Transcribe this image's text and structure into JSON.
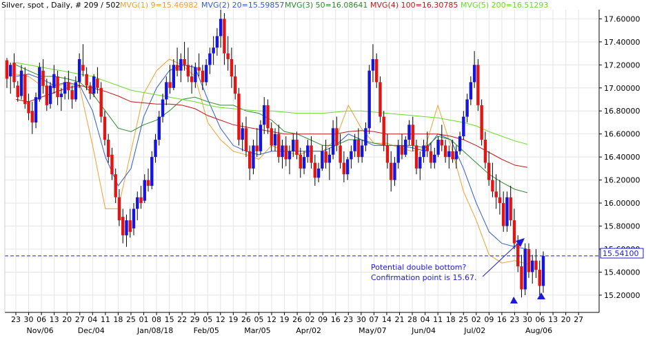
{
  "header": {
    "instrument": "Silver, spot , Daily, # 209 / 502",
    "ma_labels": [
      {
        "text": "MVG(1) 9=15.46982",
        "color": "#f0a030"
      },
      {
        "text": "MVG(2) 20=15.59857",
        "color": "#2e5bd0"
      },
      {
        "text": "MVG(3) 50=16.08641",
        "color": "#2a8a2a"
      },
      {
        "text": "MVG(4) 100=16.30785",
        "color": "#c81414"
      },
      {
        "text": "MVG(5) 200=16.51293",
        "color": "#66dd22"
      }
    ]
  },
  "annotation": {
    "line1": "Potential double bottom?",
    "line2": "Confirmation point is 15.67.",
    "color": "#1a1ad8"
  },
  "price_tag": "15.54100",
  "chart_data": {
    "type": "candlestick",
    "ylim": [
      15.05,
      17.68
    ],
    "yticks": [
      "17.60000",
      "17.40000",
      "17.20000",
      "17.00000",
      "16.80000",
      "16.60000",
      "16.40000",
      "16.20000",
      "16.00000",
      "15.80000",
      "15.60000",
      "15.40000",
      "15.20000"
    ],
    "ytick_values": [
      17.6,
      17.4,
      17.2,
      17.0,
      16.8,
      16.6,
      16.4,
      16.2,
      16.0,
      15.8,
      15.6,
      15.4,
      15.2
    ],
    "x_day_labels": [
      "23",
      "30",
      "06",
      "13",
      "20",
      "27",
      "04",
      "11",
      "18",
      "25",
      "01",
      "08",
      "15",
      "22",
      "29",
      "05",
      "12",
      "19",
      "26",
      "05",
      "12",
      "19",
      "26",
      "02",
      "09",
      "16",
      "23",
      "30",
      "07",
      "14",
      "21",
      "28",
      "04",
      "11",
      "18",
      "25",
      "02",
      "09",
      "16",
      "23",
      "30",
      "06",
      "13",
      "20",
      "27"
    ],
    "x_month_labels": [
      {
        "text": "Nov/06",
        "at": 2
      },
      {
        "text": "Dec/04",
        "at": 6
      },
      {
        "text": "Jan/08/18",
        "at": 11
      },
      {
        "text": "Feb/05",
        "at": 15
      },
      {
        "text": "Mar/05",
        "at": 19
      },
      {
        "text": "Apr/02",
        "at": 23
      },
      {
        "text": "May/07",
        "at": 28
      },
      {
        "text": "Jun/04",
        "at": 32
      },
      {
        "text": "Jul/02",
        "at": 36
      },
      {
        "text": "Aug/06",
        "at": 41
      }
    ],
    "last_price": 15.541,
    "weekly_close": [
      17.15,
      17.05,
      16.95,
      17.0,
      17.05,
      16.95,
      16.3,
      15.8,
      16.1,
      16.7,
      17.1,
      17.2,
      17.3,
      17.15,
      17.05,
      16.6,
      16.5,
      16.4,
      16.4,
      16.35,
      16.55,
      16.45,
      16.4,
      16.5,
      16.45,
      16.6,
      17.05,
      16.6,
      16.5,
      16.55,
      16.45,
      16.45,
      16.5,
      16.95,
      16.45,
      16.1,
      15.85,
      15.5,
      15.45,
      15.52,
      15.541
    ],
    "ma_series": [
      {
        "name": "MVG(1) 9",
        "color": "#f0a030",
        "values": [
          17.12,
          17.1,
          17.02,
          17.0,
          17.05,
          17.0,
          16.5,
          15.95,
          15.95,
          16.45,
          16.95,
          17.15,
          17.25,
          17.2,
          17.1,
          16.7,
          16.55,
          16.45,
          16.42,
          16.38,
          16.5,
          16.45,
          16.42,
          16.45,
          16.45,
          16.55,
          16.85,
          16.65,
          16.52,
          16.52,
          16.48,
          16.45,
          16.48,
          16.85,
          16.5,
          16.1,
          15.85,
          15.55,
          15.48,
          15.5,
          15.47
        ]
      },
      {
        "name": "MVG(2) 20",
        "color": "#2e5bd0",
        "values": [
          17.1,
          17.12,
          17.08,
          17.02,
          17.05,
          17.02,
          16.8,
          16.4,
          16.15,
          16.3,
          16.75,
          17.0,
          17.15,
          17.2,
          17.18,
          16.9,
          16.65,
          16.5,
          16.45,
          16.42,
          16.45,
          16.45,
          16.45,
          16.45,
          16.45,
          16.5,
          16.6,
          16.55,
          16.5,
          16.5,
          16.5,
          16.48,
          16.45,
          16.6,
          16.55,
          16.3,
          16.0,
          15.75,
          15.65,
          15.62,
          15.6
        ]
      },
      {
        "name": "MVG(3) 50",
        "color": "#2a8a2a",
        "values": [
          17.2,
          17.15,
          17.1,
          17.1,
          17.08,
          17.05,
          16.95,
          16.8,
          16.65,
          16.62,
          16.68,
          16.72,
          16.8,
          16.9,
          16.92,
          16.88,
          16.85,
          16.85,
          16.8,
          16.78,
          16.72,
          16.62,
          16.6,
          16.55,
          16.5,
          16.5,
          16.55,
          16.55,
          16.52,
          16.5,
          16.5,
          16.5,
          16.48,
          16.58,
          16.55,
          16.45,
          16.35,
          16.25,
          16.18,
          16.12,
          16.09
        ]
      },
      {
        "name": "MVG(4) 100",
        "color": "#c81414",
        "values": [
          16.9,
          16.88,
          16.92,
          16.96,
          17.0,
          17.02,
          17.0,
          16.97,
          16.93,
          16.88,
          16.87,
          16.86,
          16.86,
          16.85,
          16.82,
          16.76,
          16.72,
          16.68,
          16.66,
          16.64,
          16.62,
          16.6,
          16.6,
          16.6,
          16.6,
          16.6,
          16.62,
          16.63,
          16.62,
          16.6,
          16.6,
          16.6,
          16.6,
          16.6,
          16.58,
          16.55,
          16.5,
          16.44,
          16.38,
          16.33,
          16.31
        ]
      },
      {
        "name": "MVG(5) 200",
        "color": "#66dd22",
        "values": [
          17.22,
          17.2,
          17.18,
          17.16,
          17.14,
          17.12,
          17.1,
          17.06,
          17.02,
          16.98,
          16.96,
          16.94,
          16.92,
          16.9,
          16.88,
          16.85,
          16.83,
          16.82,
          16.81,
          16.8,
          16.8,
          16.79,
          16.78,
          16.78,
          16.78,
          16.79,
          16.8,
          16.8,
          16.79,
          16.78,
          16.77,
          16.76,
          16.75,
          16.74,
          16.72,
          16.7,
          16.67,
          16.62,
          16.58,
          16.54,
          16.51
        ]
      }
    ],
    "candles": [
      [
        17.24,
        17.26,
        17.0,
        17.08
      ],
      [
        17.1,
        17.22,
        16.95,
        17.2
      ],
      [
        17.22,
        17.3,
        17.0,
        17.05
      ],
      [
        17.02,
        17.06,
        16.88,
        16.92
      ],
      [
        16.93,
        17.2,
        16.9,
        17.15
      ],
      [
        17.12,
        17.18,
        16.82,
        16.86
      ],
      [
        16.88,
        16.95,
        16.72,
        16.78
      ],
      [
        16.8,
        16.88,
        16.6,
        16.7
      ],
      [
        16.7,
        16.96,
        16.65,
        16.92
      ],
      [
        16.9,
        17.22,
        16.88,
        17.18
      ],
      [
        17.15,
        17.25,
        16.95,
        17.02
      ],
      [
        17.02,
        17.08,
        16.8,
        16.85
      ],
      [
        16.86,
        17.05,
        16.82,
        17.02
      ],
      [
        17.0,
        17.2,
        16.95,
        17.12
      ],
      [
        17.1,
        17.15,
        16.85,
        16.92
      ],
      [
        16.92,
        17.0,
        16.8,
        16.95
      ],
      [
        16.95,
        17.1,
        16.9,
        17.05
      ],
      [
        17.05,
        17.15,
        16.9,
        16.98
      ],
      [
        16.98,
        17.02,
        16.82,
        16.9
      ],
      [
        16.9,
        17.1,
        16.88,
        17.05
      ],
      [
        17.05,
        17.3,
        17.0,
        17.25
      ],
      [
        17.2,
        17.38,
        17.1,
        17.15
      ],
      [
        17.12,
        17.18,
        16.98,
        17.02
      ],
      [
        17.02,
        17.05,
        16.9,
        16.95
      ],
      [
        16.95,
        17.12,
        16.92,
        17.1
      ],
      [
        17.08,
        17.18,
        16.95,
        17.0
      ],
      [
        17.0,
        17.05,
        16.7,
        16.75
      ],
      [
        16.75,
        16.8,
        16.5,
        16.55
      ],
      [
        16.55,
        16.6,
        16.35,
        16.4
      ],
      [
        16.42,
        16.48,
        16.2,
        16.25
      ],
      [
        16.25,
        16.3,
        16.0,
        16.05
      ],
      [
        16.05,
        16.12,
        15.8,
        15.85
      ],
      [
        15.88,
        15.95,
        15.65,
        15.72
      ],
      [
        15.72,
        15.9,
        15.62,
        15.85
      ],
      [
        15.85,
        15.95,
        15.7,
        15.75
      ],
      [
        15.78,
        16.0,
        15.72,
        15.95
      ],
      [
        15.95,
        16.1,
        15.85,
        16.05
      ],
      [
        16.05,
        16.15,
        15.95,
        16.0
      ],
      [
        16.02,
        16.25,
        16.0,
        16.2
      ],
      [
        16.2,
        16.3,
        16.1,
        16.15
      ],
      [
        16.15,
        16.45,
        16.12,
        16.4
      ],
      [
        16.4,
        16.6,
        16.35,
        16.55
      ],
      [
        16.55,
        16.8,
        16.5,
        16.75
      ],
      [
        16.75,
        16.95,
        16.7,
        16.9
      ],
      [
        16.9,
        17.1,
        16.85,
        17.05
      ],
      [
        17.05,
        17.2,
        16.95,
        17.0
      ],
      [
        17.0,
        17.25,
        16.98,
        17.2
      ],
      [
        17.2,
        17.35,
        17.1,
        17.15
      ],
      [
        17.15,
        17.3,
        17.05,
        17.25
      ],
      [
        17.25,
        17.4,
        17.15,
        17.2
      ],
      [
        17.2,
        17.35,
        17.05,
        17.1
      ],
      [
        17.1,
        17.2,
        16.95,
        17.05
      ],
      [
        17.05,
        17.22,
        17.0,
        17.18
      ],
      [
        17.18,
        17.3,
        17.1,
        17.15
      ],
      [
        17.15,
        17.2,
        16.98,
        17.05
      ],
      [
        17.05,
        17.25,
        17.02,
        17.2
      ],
      [
        17.2,
        17.35,
        17.12,
        17.3
      ],
      [
        17.3,
        17.45,
        17.2,
        17.35
      ],
      [
        17.35,
        17.52,
        17.28,
        17.45
      ],
      [
        17.45,
        17.68,
        17.35,
        17.6
      ],
      [
        17.6,
        17.65,
        17.2,
        17.3
      ],
      [
        17.3,
        17.45,
        17.15,
        17.25
      ],
      [
        17.25,
        17.35,
        17.0,
        17.1
      ],
      [
        17.1,
        17.2,
        16.9,
        16.95
      ],
      [
        16.95,
        17.0,
        16.5,
        16.55
      ],
      [
        16.55,
        16.7,
        16.45,
        16.65
      ],
      [
        16.65,
        16.75,
        16.4,
        16.45
      ],
      [
        16.45,
        16.5,
        16.2,
        16.3
      ],
      [
        16.3,
        16.55,
        16.25,
        16.5
      ],
      [
        16.5,
        16.65,
        16.4,
        16.45
      ],
      [
        16.45,
        16.72,
        16.42,
        16.68
      ],
      [
        16.68,
        16.92,
        16.6,
        16.85
      ],
      [
        16.85,
        16.9,
        16.6,
        16.65
      ],
      [
        16.65,
        16.7,
        16.45,
        16.5
      ],
      [
        16.5,
        16.65,
        16.45,
        16.6
      ],
      [
        16.6,
        16.68,
        16.35,
        16.4
      ],
      [
        16.4,
        16.55,
        16.3,
        16.5
      ],
      [
        16.5,
        16.58,
        16.32,
        16.38
      ],
      [
        16.38,
        16.5,
        16.25,
        16.45
      ],
      [
        16.45,
        16.6,
        16.4,
        16.55
      ],
      [
        16.55,
        16.62,
        16.38,
        16.42
      ],
      [
        16.42,
        16.48,
        16.22,
        16.3
      ],
      [
        16.3,
        16.45,
        16.25,
        16.4
      ],
      [
        16.4,
        16.55,
        16.35,
        16.5
      ],
      [
        16.5,
        16.58,
        16.3,
        16.35
      ],
      [
        16.35,
        16.42,
        16.15,
        16.22
      ],
      [
        16.22,
        16.35,
        16.18,
        16.3
      ],
      [
        16.3,
        16.5,
        16.28,
        16.45
      ],
      [
        16.45,
        16.55,
        16.3,
        16.35
      ],
      [
        16.35,
        16.48,
        16.2,
        16.42
      ],
      [
        16.42,
        16.72,
        16.38,
        16.65
      ],
      [
        16.65,
        16.75,
        16.45,
        16.5
      ],
      [
        16.5,
        16.6,
        16.3,
        16.35
      ],
      [
        16.35,
        16.45,
        16.18,
        16.25
      ],
      [
        16.25,
        16.4,
        16.2,
        16.38
      ],
      [
        16.38,
        16.5,
        16.3,
        16.45
      ],
      [
        16.45,
        16.6,
        16.4,
        16.55
      ],
      [
        16.55,
        16.65,
        16.35,
        16.4
      ],
      [
        16.4,
        16.55,
        16.35,
        16.5
      ],
      [
        16.5,
        16.7,
        16.45,
        16.65
      ],
      [
        16.65,
        17.2,
        16.6,
        17.15
      ],
      [
        17.15,
        17.38,
        17.05,
        17.25
      ],
      [
        17.25,
        17.3,
        17.0,
        17.05
      ],
      [
        17.05,
        17.1,
        16.7,
        16.75
      ],
      [
        16.75,
        16.8,
        16.45,
        16.5
      ],
      [
        16.5,
        16.6,
        16.3,
        16.35
      ],
      [
        16.35,
        16.45,
        16.1,
        16.2
      ],
      [
        16.2,
        16.4,
        16.15,
        16.35
      ],
      [
        16.35,
        16.55,
        16.3,
        16.5
      ],
      [
        16.5,
        16.6,
        16.38,
        16.42
      ],
      [
        16.42,
        16.58,
        16.4,
        16.55
      ],
      [
        16.55,
        16.72,
        16.5,
        16.68
      ],
      [
        16.68,
        16.75,
        16.45,
        16.5
      ],
      [
        16.5,
        16.55,
        16.25,
        16.3
      ],
      [
        16.3,
        16.45,
        16.2,
        16.4
      ],
      [
        16.4,
        16.55,
        16.35,
        16.5
      ],
      [
        16.5,
        16.62,
        16.4,
        16.45
      ],
      [
        16.45,
        16.52,
        16.3,
        16.35
      ],
      [
        16.35,
        16.48,
        16.3,
        16.42
      ],
      [
        16.42,
        16.58,
        16.4,
        16.55
      ],
      [
        16.55,
        16.68,
        16.45,
        16.5
      ],
      [
        16.5,
        16.55,
        16.35,
        16.4
      ],
      [
        16.4,
        16.5,
        16.3,
        16.45
      ],
      [
        16.45,
        16.55,
        16.35,
        16.38
      ],
      [
        16.38,
        16.5,
        16.3,
        16.45
      ],
      [
        16.45,
        16.62,
        16.42,
        16.58
      ],
      [
        16.58,
        16.8,
        16.55,
        16.75
      ],
      [
        16.75,
        16.95,
        16.7,
        16.9
      ],
      [
        16.9,
        17.1,
        16.85,
        17.05
      ],
      [
        17.05,
        17.32,
        17.0,
        17.2
      ],
      [
        17.2,
        17.25,
        16.8,
        16.85
      ],
      [
        16.85,
        16.9,
        16.5,
        16.55
      ],
      [
        16.55,
        16.62,
        16.3,
        16.35
      ],
      [
        16.35,
        16.45,
        16.15,
        16.2
      ],
      [
        16.2,
        16.35,
        16.05,
        16.1
      ],
      [
        16.1,
        16.25,
        15.95,
        16.05
      ],
      [
        16.05,
        16.2,
        15.9,
        16.0
      ],
      [
        16.0,
        16.1,
        15.75,
        15.8
      ],
      [
        15.8,
        16.1,
        15.75,
        16.05
      ],
      [
        16.05,
        16.15,
        15.8,
        15.85
      ],
      [
        15.85,
        15.95,
        15.6,
        15.65
      ],
      [
        15.65,
        15.72,
        15.4,
        15.45
      ],
      [
        15.45,
        15.55,
        15.18,
        15.25
      ],
      [
        15.25,
        15.65,
        15.2,
        15.6
      ],
      [
        15.6,
        15.65,
        15.35,
        15.4
      ],
      [
        15.4,
        15.55,
        15.3,
        15.5
      ],
      [
        15.5,
        15.6,
        15.35,
        15.42
      ],
      [
        15.42,
        15.5,
        15.2,
        15.28
      ],
      [
        15.28,
        15.58,
        15.22,
        15.541
      ]
    ]
  }
}
